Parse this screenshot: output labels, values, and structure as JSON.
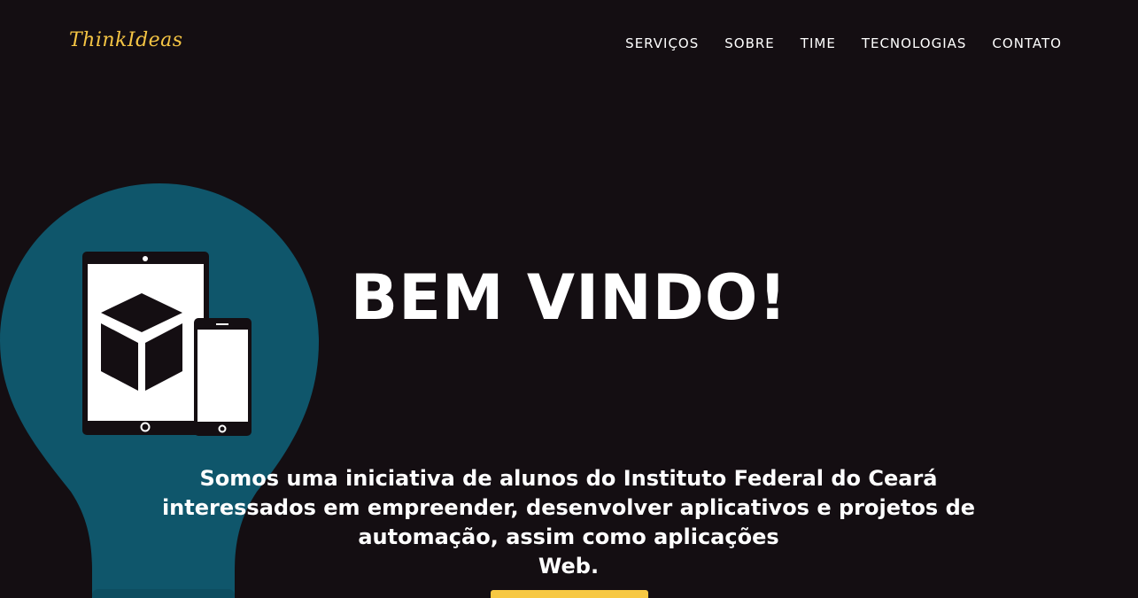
{
  "navbar": {
    "brand": "ThinkIdeas",
    "links": [
      {
        "label": "SERVIÇOS"
      },
      {
        "label": "SOBRE"
      },
      {
        "label": "TIME"
      },
      {
        "label": "TECNOLOGIAS"
      },
      {
        "label": "CONTATO"
      }
    ]
  },
  "hero": {
    "title": "BEM VINDO!",
    "subtitle_lines": [
      "Somos uma iniciativa de alunos do Instituto Federal do Ceará",
      "interessados em empreender, desenvolver aplicativos e projetos de",
      "automação, assim como aplicações",
      "Web."
    ]
  },
  "colors": {
    "background": "#140e12",
    "brand": "#f5c544",
    "bulb": "#0f566b",
    "button": "#f7c843",
    "text": "#ffffff"
  },
  "icons": {
    "hero_art": "lightbulb-devices-illustration",
    "cube": "cube-icon",
    "tablet": "tablet-icon",
    "phone": "phone-icon"
  }
}
